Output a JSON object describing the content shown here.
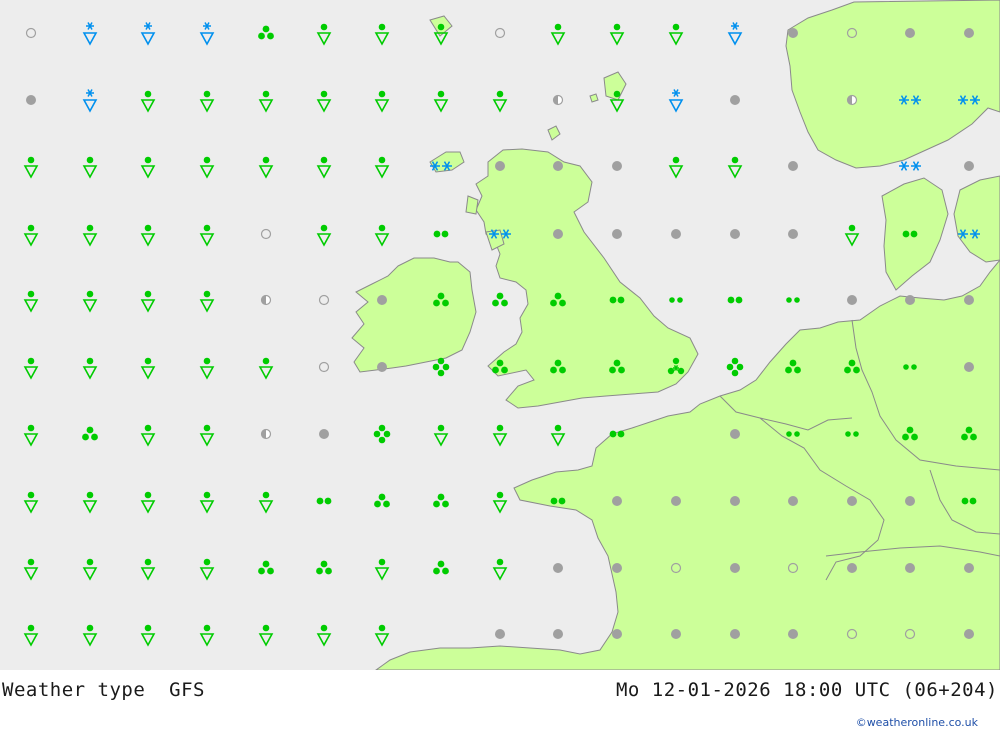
{
  "title": "Weather type",
  "model": "GFS",
  "datetime": "Mo 12-01-2026 18:00 UTC (06+204)",
  "credit": "©weatheronline.co.uk",
  "colors": {
    "sea": "#ededed",
    "land": "#ccff99",
    "border": "#8a8a8a",
    "rain": "#00cc00",
    "snow": "#0090ee",
    "cloud": "#a0a0a0"
  },
  "grid": {
    "cols": [
      31,
      90,
      148,
      207,
      266,
      324,
      382,
      441,
      500,
      558,
      617,
      676,
      735,
      793,
      852,
      910,
      969
    ],
    "rows": [
      33,
      100,
      166,
      234,
      300,
      367,
      434,
      501,
      568,
      634
    ],
    "symbols": [
      [
        "o",
        "SS",
        "SS",
        "SS",
        "R3",
        "SH",
        "SH",
        "SH",
        "o",
        "SH",
        "SH",
        "SH",
        "SS",
        "C",
        "o",
        "C",
        "C"
      ],
      [
        "C",
        "SS",
        "SH",
        "SH",
        "SH",
        "SH",
        "SH",
        "SH",
        "SH",
        "H",
        "SH",
        "SS",
        "C",
        "",
        "H",
        "SN2",
        "SN2"
      ],
      [
        "SH",
        "SH",
        "SH",
        "SH",
        "SH",
        "SH",
        "SH",
        "SN2",
        "C",
        "C",
        "C",
        "SH",
        "SH",
        "C",
        "",
        "SN2",
        "C"
      ],
      [
        "SH",
        "SH",
        "SH",
        "SH",
        "o",
        "SH",
        "SH",
        "R2",
        "SN2",
        "C",
        "C",
        "C",
        "C",
        "C",
        "SH",
        "R2",
        "SN2"
      ],
      [
        "SH",
        "SH",
        "SH",
        "SH",
        "H",
        "o",
        "C",
        "R3",
        "R3",
        "R3",
        "R2",
        "R2s",
        "R2",
        "R2s",
        "C",
        "C",
        "C"
      ],
      [
        "SH",
        "SH",
        "SH",
        "SH",
        "SH",
        "o",
        "C",
        "R4",
        "R3",
        "R3",
        "R3",
        "RS",
        "R4",
        "R3",
        "R3",
        "R2s",
        "C"
      ],
      [
        "SH",
        "R3",
        "SH",
        "SH",
        "H",
        "C",
        "R4",
        "SH",
        "SH",
        "SH",
        "R2",
        "",
        "C",
        "R2s",
        "R2s",
        "R3",
        "R3"
      ],
      [
        "SH",
        "SH",
        "SH",
        "SH",
        "SH",
        "R2",
        "R3",
        "R3",
        "SH",
        "R2",
        "C",
        "C",
        "C",
        "C",
        "C",
        "C",
        "R2"
      ],
      [
        "SH",
        "SH",
        "SH",
        "SH",
        "R3",
        "R3",
        "SH",
        "R3",
        "SH",
        "C",
        "C",
        "o",
        "C",
        "o",
        "C",
        "C",
        "C"
      ],
      [
        "SH",
        "SH",
        "SH",
        "SH",
        "SH",
        "SH",
        "SH",
        "",
        "C",
        "C",
        "C",
        "C",
        "C",
        "C",
        "o",
        "o",
        "C"
      ]
    ]
  }
}
